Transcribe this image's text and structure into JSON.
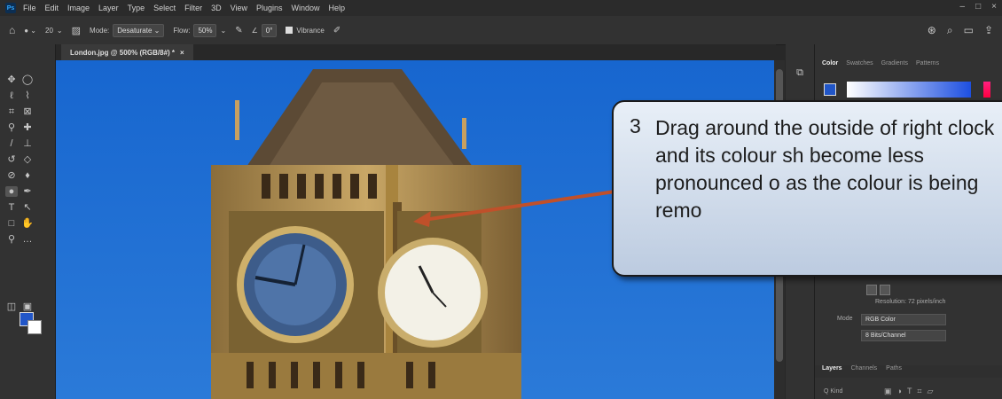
{
  "menubar": {
    "logo": "Ps",
    "items": [
      "File",
      "Edit",
      "Image",
      "Layer",
      "Type",
      "Select",
      "Filter",
      "3D",
      "View",
      "Plugins",
      "Window",
      "Help"
    ]
  },
  "options": {
    "brush_size": "20",
    "mode_label": "Mode:",
    "mode_value": "Desaturate",
    "flow_label": "Flow:",
    "flow_value": "50%",
    "angle_value": "0°",
    "vibrance_label": "Vibrance"
  },
  "document": {
    "tab_title": "London.jpg @ 500% (RGB/8#) *",
    "close": "×"
  },
  "panel": {
    "tabs": [
      "Color",
      "Swatches",
      "Gradients",
      "Patterns"
    ],
    "resolution_text": "Resolution: 72 pixels/inch",
    "mode_label": "Mode",
    "mode_value": "RGB Color",
    "bits_value": "8 Bits/Channel",
    "layer_tabs": [
      "Layers",
      "Channels",
      "Paths"
    ],
    "kind_placeholder": "Q Kind"
  },
  "callout": {
    "step": "3",
    "text": "Drag around the outside of right clock and its colour sh become less pronounced o as the colour is being remo"
  },
  "colors": {
    "foreground": "#2156c8",
    "background": "#ffffff",
    "sky": "#1a6ad0",
    "arrow": "#c0502a"
  }
}
